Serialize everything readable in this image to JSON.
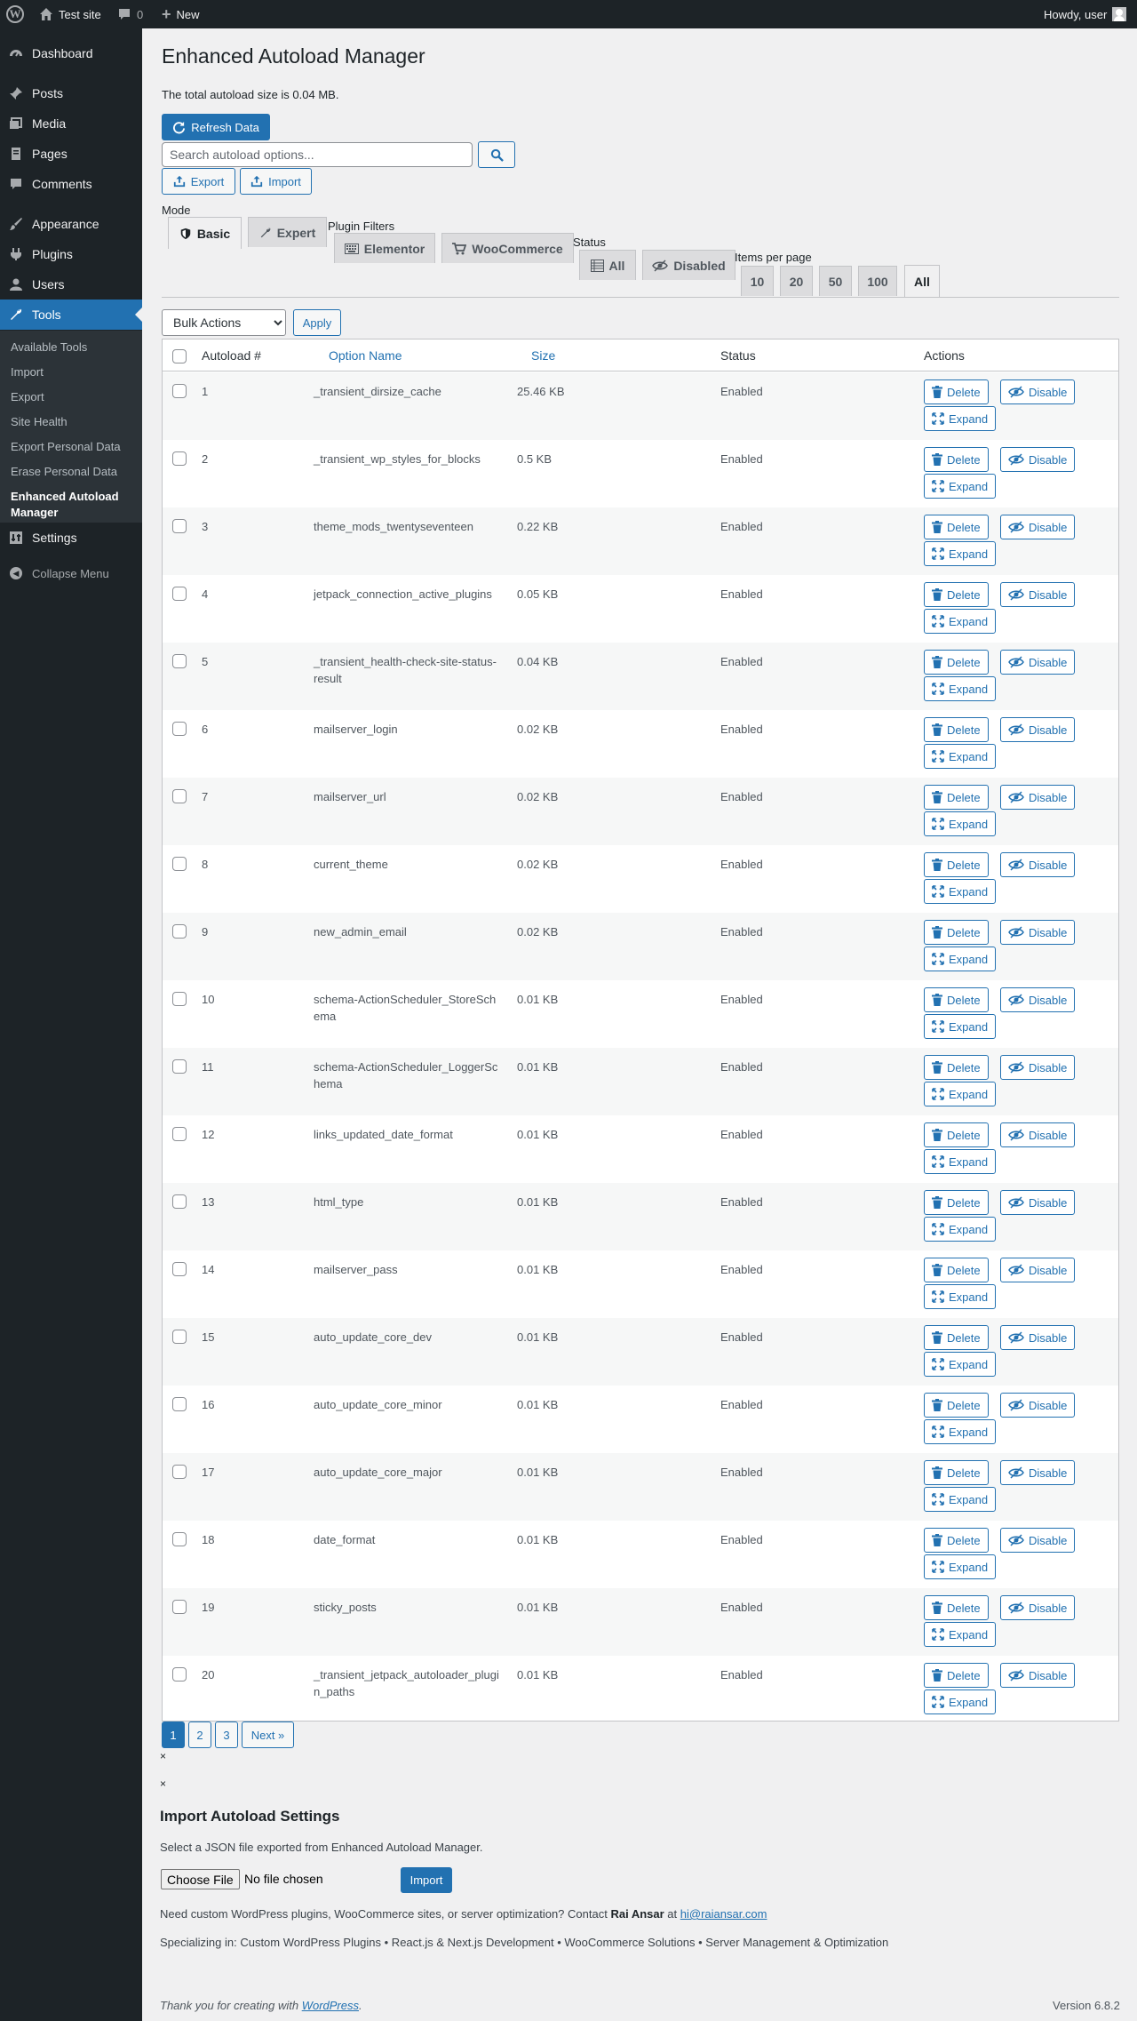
{
  "admin_bar": {
    "site_name": "Test site",
    "comments_count": "0",
    "new_label": "New",
    "greeting": "Howdy, user"
  },
  "sidebar": {
    "items": [
      {
        "label": "Dashboard",
        "icon": "dashboard-icon"
      },
      {
        "label": "Posts",
        "icon": "pin-icon"
      },
      {
        "label": "Media",
        "icon": "media-icon"
      },
      {
        "label": "Pages",
        "icon": "page-icon"
      },
      {
        "label": "Comments",
        "icon": "comment-icon"
      },
      {
        "label": "Appearance",
        "icon": "brush-icon"
      },
      {
        "label": "Plugins",
        "icon": "plug-icon"
      },
      {
        "label": "Users",
        "icon": "user-icon"
      },
      {
        "label": "Tools",
        "icon": "wrench-icon"
      },
      {
        "label": "Settings",
        "icon": "settings-icon"
      }
    ],
    "submenu": [
      "Available Tools",
      "Import",
      "Export",
      "Site Health",
      "Export Personal Data",
      "Erase Personal Data",
      "Enhanced Autoload Manager"
    ],
    "collapse_label": "Collapse Menu"
  },
  "page": {
    "title": "Enhanced Autoload Manager",
    "total_size": "The total autoload size is 0.04 MB.",
    "refresh_label": "Refresh Data",
    "search_placeholder": "Search autoload options...",
    "export_label": "Export",
    "import_label": "Import",
    "mode_label": "Mode",
    "mode_tabs": [
      "Basic",
      "Expert"
    ],
    "plugin_filters_label": "Plugin Filters",
    "plugin_tabs": [
      "Elementor",
      "WooCommerce"
    ],
    "status_label": "Status",
    "status_tabs": [
      "All",
      "Disabled"
    ],
    "items_per_page_label": "Items per page",
    "per_page_tabs": [
      "10",
      "20",
      "50",
      "100",
      "All"
    ],
    "bulk_actions": "Bulk Actions",
    "apply_label": "Apply"
  },
  "table": {
    "headers": [
      "Autoload #",
      "Option Name",
      "Size",
      "Status",
      "Actions"
    ],
    "action_labels": {
      "delete": "Delete",
      "disable": "Disable",
      "expand": "Expand"
    },
    "rows": [
      {
        "num": "1",
        "name": "_transient_dirsize_cache",
        "size": "25.46 KB",
        "status": "Enabled"
      },
      {
        "num": "2",
        "name": "_transient_wp_styles_for_blocks",
        "size": "0.5 KB",
        "status": "Enabled"
      },
      {
        "num": "3",
        "name": "theme_mods_twentyseventeen",
        "size": "0.22 KB",
        "status": "Enabled"
      },
      {
        "num": "4",
        "name": "jetpack_connection_active_plugins",
        "size": "0.05 KB",
        "status": "Enabled"
      },
      {
        "num": "5",
        "name": "_transient_health-check-site-status-result",
        "size": "0.04 KB",
        "status": "Enabled"
      },
      {
        "num": "6",
        "name": "mailserver_login",
        "size": "0.02 KB",
        "status": "Enabled"
      },
      {
        "num": "7",
        "name": "mailserver_url",
        "size": "0.02 KB",
        "status": "Enabled"
      },
      {
        "num": "8",
        "name": "current_theme",
        "size": "0.02 KB",
        "status": "Enabled"
      },
      {
        "num": "9",
        "name": "new_admin_email",
        "size": "0.02 KB",
        "status": "Enabled"
      },
      {
        "num": "10",
        "name": "schema-ActionScheduler_StoreSchema",
        "size": "0.01 KB",
        "status": "Enabled"
      },
      {
        "num": "11",
        "name": "schema-ActionScheduler_LoggerSchema",
        "size": "0.01 KB",
        "status": "Enabled"
      },
      {
        "num": "12",
        "name": "links_updated_date_format",
        "size": "0.01 KB",
        "status": "Enabled"
      },
      {
        "num": "13",
        "name": "html_type",
        "size": "0.01 KB",
        "status": "Enabled"
      },
      {
        "num": "14",
        "name": "mailserver_pass",
        "size": "0.01 KB",
        "status": "Enabled"
      },
      {
        "num": "15",
        "name": "auto_update_core_dev",
        "size": "0.01 KB",
        "status": "Enabled"
      },
      {
        "num": "16",
        "name": "auto_update_core_minor",
        "size": "0.01 KB",
        "status": "Enabled"
      },
      {
        "num": "17",
        "name": "auto_update_core_major",
        "size": "0.01 KB",
        "status": "Enabled"
      },
      {
        "num": "18",
        "name": "date_format",
        "size": "0.01 KB",
        "status": "Enabled"
      },
      {
        "num": "19",
        "name": "sticky_posts",
        "size": "0.01 KB",
        "status": "Enabled"
      },
      {
        "num": "20",
        "name": "_transient_jetpack_autoloader_plugin_paths",
        "size": "0.01 KB",
        "status": "Enabled"
      }
    ]
  },
  "pagination": {
    "pages": [
      "1",
      "2",
      "3"
    ],
    "next": "Next »",
    "current": "1"
  },
  "import_section": {
    "close_mark_1": "×",
    "close_mark_2": "×",
    "title": "Import Autoload Settings",
    "description": "Select a JSON file exported from Enhanced Autoload Manager.",
    "choose_file": "Choose File",
    "no_file": "No file chosen",
    "import_button": "Import"
  },
  "promo": {
    "contact_prefix": "Need custom WordPress plugins, WooCommerce sites, or server optimization? Contact ",
    "contact_name": "Rai Ansar",
    "contact_at": " at ",
    "contact_email": "hi@raiansar.com",
    "specializing": "Specializing in: Custom WordPress Plugins • React.js & Next.js Development • WooCommerce Solutions • Server Management & Optimization"
  },
  "footer": {
    "thanks_prefix": "Thank you for creating with ",
    "thanks_link": "WordPress",
    "thanks_suffix": ".",
    "version": "Version 6.8.2"
  },
  "colors": {
    "accent": "#2271b1",
    "sidebar_bg": "#1d2327",
    "submenu_bg": "#2c3338",
    "page_bg": "#f0f0f1"
  }
}
